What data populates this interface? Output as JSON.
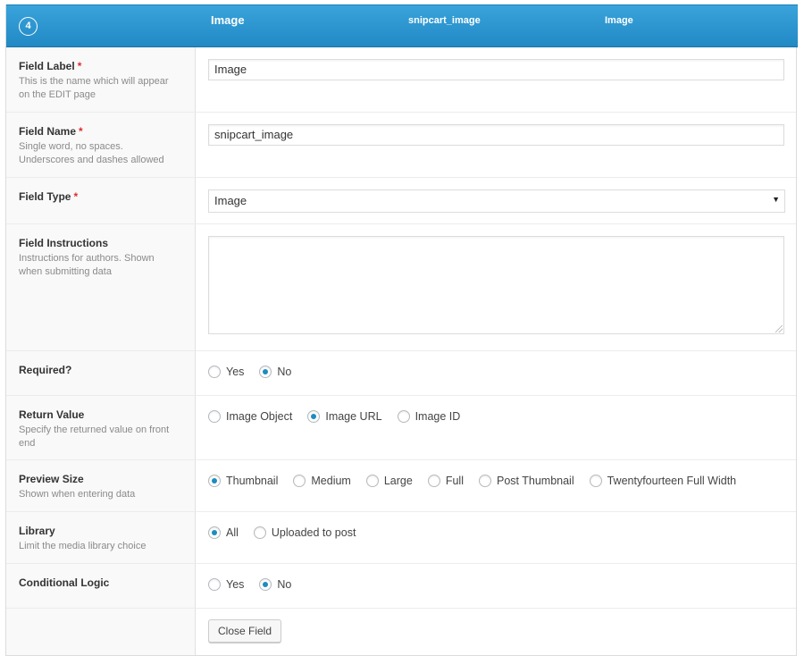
{
  "header": {
    "order": "4",
    "label": "Image",
    "name": "snipcart_image",
    "type": "Image"
  },
  "fields": {
    "label": {
      "title": "Field Label",
      "required": "*",
      "desc1": "This is the name which will appear",
      "desc2": "on the EDIT page",
      "value": "Image"
    },
    "name": {
      "title": "Field Name",
      "required": "*",
      "desc1": "Single word, no spaces.",
      "desc2": "Underscores and dashes allowed",
      "value": "snipcart_image"
    },
    "type": {
      "title": "Field Type",
      "required": "*",
      "value": "Image"
    },
    "instructions": {
      "title": "Field Instructions",
      "desc1": "Instructions for authors. Shown",
      "desc2": "when submitting data",
      "value": ""
    },
    "required": {
      "title": "Required?",
      "options": [
        "Yes",
        "No"
      ],
      "selected": "No"
    },
    "return_value": {
      "title": "Return Value",
      "desc1": "Specify the returned value on front",
      "desc2": "end",
      "options": [
        "Image Object",
        "Image URL",
        "Image ID"
      ],
      "selected": "Image URL"
    },
    "preview_size": {
      "title": "Preview Size",
      "desc1": "Shown when entering data",
      "options": [
        "Thumbnail",
        "Medium",
        "Large",
        "Full",
        "Post Thumbnail",
        "Twentyfourteen Full Width"
      ],
      "selected": "Thumbnail"
    },
    "library": {
      "title": "Library",
      "desc1": "Limit the media library choice",
      "options": [
        "All",
        "Uploaded to post"
      ],
      "selected": "All"
    },
    "conditional_logic": {
      "title": "Conditional Logic",
      "options": [
        "Yes",
        "No"
      ],
      "selected": "No"
    }
  },
  "close_button": "Close Field",
  "colors": {
    "header": "#2a95d0",
    "accent": "#1e8cbe",
    "required": "#e02b2b"
  }
}
